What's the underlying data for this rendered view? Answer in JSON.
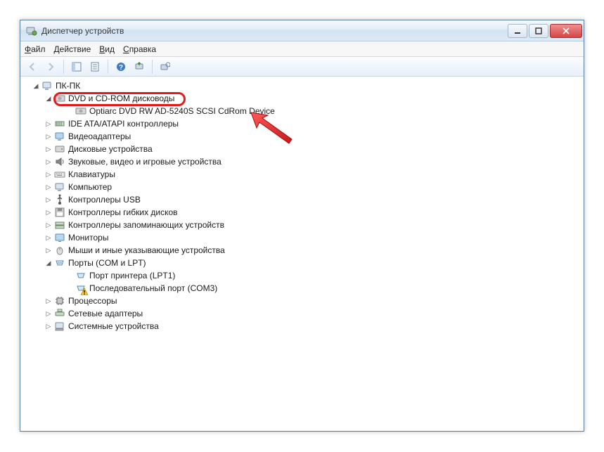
{
  "window": {
    "title": "Диспетчер устройств"
  },
  "menu": {
    "file": "Файл",
    "action": "Действие",
    "view": "Вид",
    "help": "Справка"
  },
  "toolbar": {
    "back": "Назад",
    "forward": "Вперед",
    "props": "Свойства",
    "list": "Показать/скрыть дерево",
    "help": "Справка",
    "scan": "Обновить конфигурацию оборудования",
    "legacy": "Установить старое устройство"
  },
  "tree": {
    "root": "ПК-ПК",
    "dvd": {
      "label": "DVD и CD-ROM дисководы",
      "child": "Optiarc DVD RW AD-5240S SCSI CdRom Device"
    },
    "ide": "IDE ATA/ATAPI контроллеры",
    "video": "Видеоадаптеры",
    "disk": "Дисковые устройства",
    "sound": "Звуковые, видео и игровые устройства",
    "keyboard": "Клавиатуры",
    "computer": "Компьютер",
    "usb": "Контроллеры USB",
    "floppy": "Контроллеры гибких дисков",
    "storage": "Контроллеры запоминающих устройств",
    "monitor": "Мониторы",
    "mouse": "Мыши и иные указывающие устройства",
    "ports": {
      "label": "Порты (COM и LPT)",
      "lpt": "Порт принтера (LPT1)",
      "com": "Последовательный порт (COM3)"
    },
    "cpu": "Процессоры",
    "net": "Сетевые адаптеры",
    "system": "Системные устройства"
  }
}
